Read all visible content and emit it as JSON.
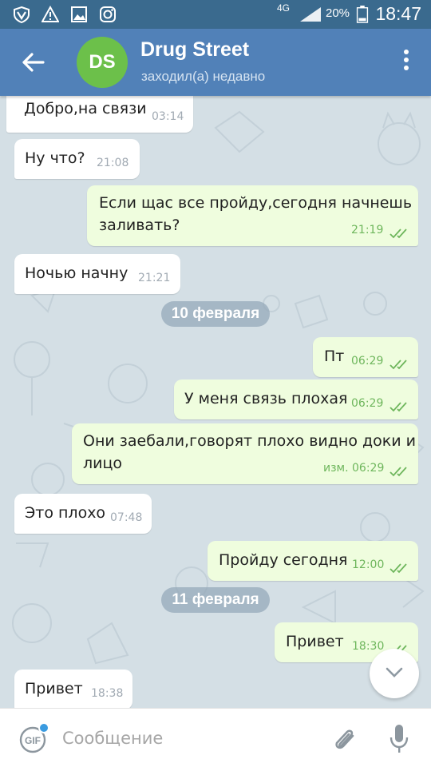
{
  "status_bar": {
    "network": "4G",
    "battery_percent": "20%",
    "time": "18:47",
    "icons": [
      "vpn-shield-icon",
      "warning-icon",
      "gallery-icon",
      "instagram-icon",
      "signal-icon",
      "battery-icon"
    ]
  },
  "header": {
    "avatar_initials": "DS",
    "avatar_color": "#6cc04a",
    "title": "Drug Street",
    "status": "заходил(а) недавно",
    "background": "#5181b8"
  },
  "messages": [
    {
      "direction": "in",
      "text": "Добро,на связи",
      "time": "03:14"
    },
    {
      "direction": "in",
      "text": "Ну что?",
      "time": "21:08"
    },
    {
      "direction": "out",
      "text": "Если щас все пройду,сегодня начнешь",
      "text_line2": "заливать?",
      "time": "21:19"
    },
    {
      "direction": "in",
      "text": "Ночью начну",
      "time": "21:21"
    },
    {
      "direction": "out",
      "text": "Пт",
      "time": "06:29"
    },
    {
      "direction": "out",
      "text": "У меня связь плохая",
      "time": "06:29"
    },
    {
      "direction": "out",
      "text": "Они заебали,говорят плохо видно доки и",
      "text_line2": "лицо",
      "time": "изм. 06:29"
    },
    {
      "direction": "in",
      "text": "Это плохо",
      "time": "07:48"
    },
    {
      "direction": "out",
      "text": "Пройду сегодня",
      "time": "12:00"
    },
    {
      "direction": "out",
      "text": "Привет",
      "time": "18:30"
    },
    {
      "direction": "in",
      "text": "Привет",
      "time": "18:38"
    }
  ],
  "date_separators": [
    "10 февраля",
    "11 февраля"
  ],
  "input": {
    "placeholder": "Сообщение",
    "value": ""
  },
  "colors": {
    "outgoing_bubble": "#effdde",
    "incoming_bubble": "#ffffff",
    "read_ticks": "#6eb65c",
    "chat_background": "#d4dfe5"
  }
}
